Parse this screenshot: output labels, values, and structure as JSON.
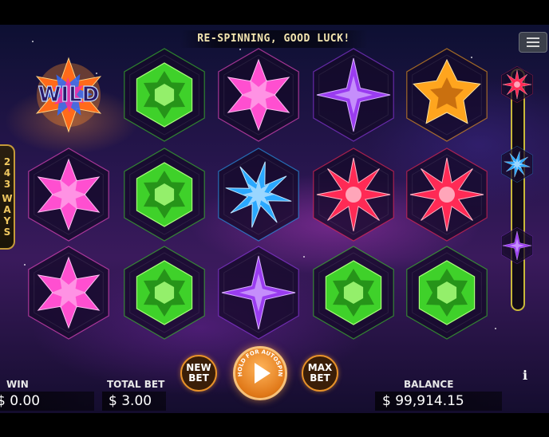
{
  "banner": {
    "message": "RE-SPINNING, GOOD LUCK!"
  },
  "ways": {
    "count": "243",
    "label": "WAYS"
  },
  "grid": {
    "rows": [
      [
        {
          "symbol": "wild",
          "text": "WILD"
        },
        {
          "symbol": "green-gem"
        },
        {
          "symbol": "pink-gem"
        },
        {
          "symbol": "purple-gem"
        },
        {
          "symbol": "orange-gem"
        }
      ],
      [
        {
          "symbol": "pink-gem"
        },
        {
          "symbol": "green-gem"
        },
        {
          "symbol": "blue-gem"
        },
        {
          "symbol": "red-gem"
        },
        {
          "symbol": "red-gem"
        }
      ],
      [
        {
          "symbol": "pink-gem"
        },
        {
          "symbol": "green-gem"
        },
        {
          "symbol": "purple-gem"
        },
        {
          "symbol": "green-gem"
        },
        {
          "symbol": "green-gem"
        }
      ]
    ]
  },
  "side_reel": {
    "symbols": [
      "red-gem",
      "blue-gem",
      "purple-gem"
    ]
  },
  "bottom": {
    "win_label": "WIN",
    "win_value": "$ 0.00",
    "total_bet_label": "TOTAL BET",
    "total_bet_value": "$ 3.00",
    "new_bet_line1": "NEW",
    "new_bet_line2": "BET",
    "spin_hint": "HOLD FOR AUTOSPIN",
    "max_bet_line1": "MAX",
    "max_bet_line2": "BET",
    "balance_label": "BALANCE",
    "balance_value": "$ 99,914.15",
    "info": "i"
  },
  "colors": {
    "accent": "#e8922a",
    "banner_text": "#f4e6b0",
    "green_gem": "#3fd12a",
    "pink_gem": "#ff4fd0",
    "purple_gem": "#9a3cf0",
    "orange_gem": "#ffa51e",
    "red_gem": "#ff2a55",
    "blue_gem": "#2aa8ff"
  }
}
